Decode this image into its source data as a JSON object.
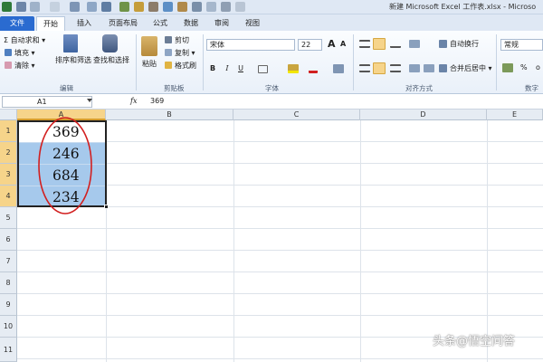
{
  "title": "新建 Microsoft Excel 工作表.xlsx - Microso",
  "tabs": [
    "文件",
    "开始",
    "插入",
    "页面布局",
    "公式",
    "数据",
    "审阅",
    "视图"
  ],
  "editing": {
    "autosum": "Σ 自动求和 ▾",
    "fill": "填充 ▾",
    "clear": "清除 ▾",
    "sort": "排序和筛选",
    "find": "查找和选择",
    "group": "编辑"
  },
  "clipboard": {
    "paste": "粘贴",
    "cut": "剪切",
    "copy": "复制 ▾",
    "format_painter": "格式刷",
    "group": "剪贴板"
  },
  "font": {
    "name": "宋体",
    "size": "22",
    "grow": "A",
    "shrink": "A",
    "bold": "B",
    "italic": "I",
    "underline": "U",
    "group": "字体"
  },
  "alignment": {
    "wrap": "自动换行",
    "merge": "合并后居中 ▾",
    "group": "对齐方式"
  },
  "number": {
    "format": "常规",
    "percent": "%",
    "comma": "o",
    "group": "数字"
  },
  "formula_bar": {
    "cell_ref": "A1",
    "fx": "fx",
    "value": "369"
  },
  "columns": [
    "A",
    "B",
    "C",
    "D",
    "E"
  ],
  "rows": [
    "1",
    "2",
    "3",
    "4",
    "5",
    "6",
    "7",
    "8",
    "9",
    "10",
    "11"
  ],
  "cells": [
    "369",
    "246",
    "684",
    "234"
  ],
  "watermark": "头条@悟空问答",
  "colors": {
    "accent_file_tab": "#2a6bd0",
    "selection": "#a6c9ec",
    "row_col_selected": "#f6d48a",
    "annotation_ring": "#d21f1f"
  }
}
